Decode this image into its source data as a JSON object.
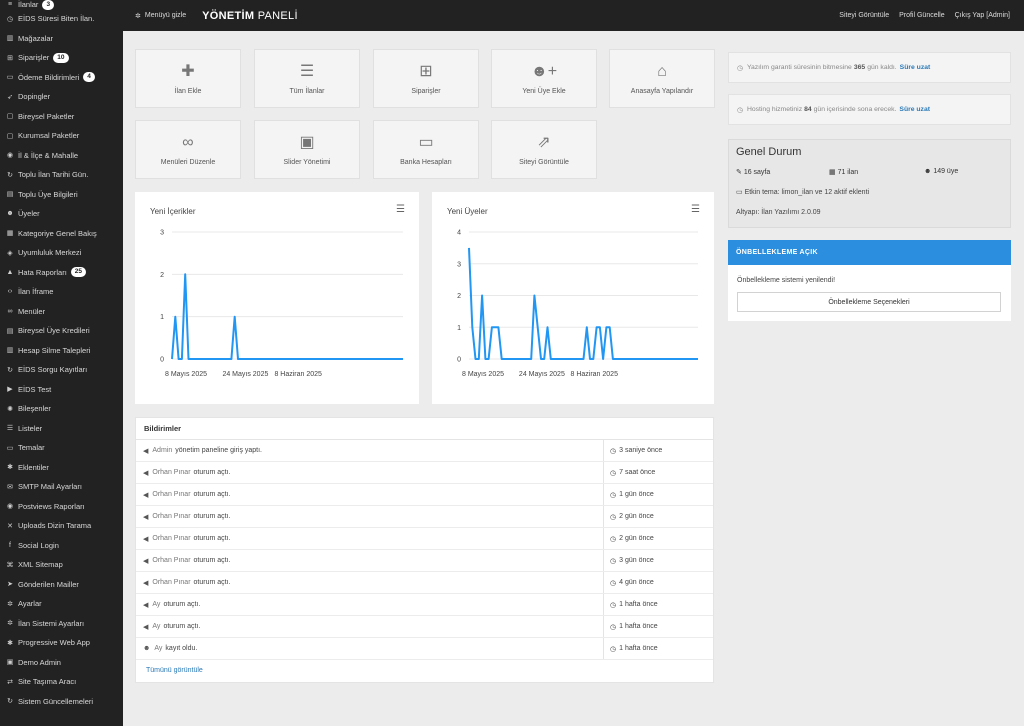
{
  "sidebar": {
    "items": [
      {
        "label": "İlanlar",
        "icon": "list-icon",
        "glyph": "≡",
        "badge": "3"
      },
      {
        "label": "EİDS Süresi Biten İlan.",
        "icon": "clock-icon",
        "glyph": "◷"
      },
      {
        "label": "Mağazalar",
        "icon": "store-icon",
        "glyph": "▥"
      },
      {
        "label": "Siparişler",
        "icon": "cart-icon",
        "glyph": "⊞",
        "badge": "10"
      },
      {
        "label": "Ödeme Bildirimleri",
        "icon": "money-icon",
        "glyph": "▭",
        "badge": "4"
      },
      {
        "label": "Dopingler",
        "icon": "rocket-icon",
        "glyph": "➶"
      },
      {
        "label": "Bireysel Paketler",
        "icon": "box-icon",
        "glyph": "▢"
      },
      {
        "label": "Kurumsal Paketler",
        "icon": "box-icon",
        "glyph": "▢"
      },
      {
        "label": "İl & İlçe & Mahalle",
        "icon": "map-marker-icon",
        "glyph": "◉"
      },
      {
        "label": "Toplu İlan Tarihi Gün.",
        "icon": "refresh-icon",
        "glyph": "↻"
      },
      {
        "label": "Toplu Üye Bilgileri",
        "icon": "users-icon",
        "glyph": "▤"
      },
      {
        "label": "Üyeler",
        "icon": "users-icon",
        "glyph": "☻"
      },
      {
        "label": "Kategoriye Genel Bakış",
        "icon": "grid-icon",
        "glyph": "▦"
      },
      {
        "label": "Uyumluluk Merkezi",
        "icon": "shield-icon",
        "glyph": "◈"
      },
      {
        "label": "Hata Raporları",
        "icon": "bell-icon",
        "glyph": "▲",
        "badge": "25"
      },
      {
        "label": "İlan İframe",
        "icon": "code-icon",
        "glyph": "‹›"
      },
      {
        "label": "Menüler",
        "icon": "link-icon",
        "glyph": "∞"
      },
      {
        "label": "Bireysel Üye Kredileri",
        "icon": "credit-icon",
        "glyph": "▤"
      },
      {
        "label": "Hesap Silme Talepleri",
        "icon": "trash-icon",
        "glyph": "▥"
      },
      {
        "label": "EİDS Sorgu Kayıtları",
        "icon": "refresh-icon",
        "glyph": "↻"
      },
      {
        "label": "EİDS Test",
        "icon": "play-icon",
        "glyph": "▶"
      },
      {
        "label": "Bileşenler",
        "icon": "gear-icon",
        "glyph": "✺"
      },
      {
        "label": "Listeler",
        "icon": "list-icon",
        "glyph": "☰"
      },
      {
        "label": "Temalar",
        "icon": "paint-icon",
        "glyph": "▭"
      },
      {
        "label": "Eklentiler",
        "icon": "puzzle-icon",
        "glyph": "✱"
      },
      {
        "label": "SMTP Mail Ayarları",
        "icon": "mail-icon",
        "glyph": "✉"
      },
      {
        "label": "Postviews Raporları",
        "icon": "eye-icon",
        "glyph": "◉"
      },
      {
        "label": "Uploads Dizin Tarama",
        "icon": "close-icon",
        "glyph": "✕"
      },
      {
        "label": "Social Login",
        "icon": "facebook-icon",
        "glyph": "f"
      },
      {
        "label": "XML Sitemap",
        "icon": "sitemap-icon",
        "glyph": "⌘"
      },
      {
        "label": "Gönderilen Mailler",
        "icon": "send-icon",
        "glyph": "➤"
      },
      {
        "label": "Ayarlar",
        "icon": "gear-icon",
        "glyph": "✲"
      },
      {
        "label": "İlan Sistemi Ayarları",
        "icon": "gears-icon",
        "glyph": "✲"
      },
      {
        "label": "Progressive Web App",
        "icon": "mobile-icon",
        "glyph": "✱"
      },
      {
        "label": "Demo Admin",
        "icon": "lock-icon",
        "glyph": "▣"
      },
      {
        "label": "Site Taşıma Aracı",
        "icon": "truck-icon",
        "glyph": "⇄"
      },
      {
        "label": "Sistem Güncellemeleri",
        "icon": "refresh-icon",
        "glyph": "↻"
      }
    ]
  },
  "topbar": {
    "menu_toggle": "Menüyü gizle",
    "brand_bold": "YÖNETİM",
    "brand_rest": " PANELİ",
    "links": [
      "Siteyi Görüntüle",
      "Profil Güncelle",
      "Çıkış Yap [Admin]"
    ]
  },
  "tiles": [
    {
      "label": "İlan Ekle",
      "icon": "plus-icon",
      "glyph": "✚"
    },
    {
      "label": "Tüm İlanlar",
      "icon": "list-icon",
      "glyph": "☰"
    },
    {
      "label": "Siparişler",
      "icon": "cart-icon",
      "glyph": "⊞"
    },
    {
      "label": "Yeni Üye Ekle",
      "icon": "user-plus-icon",
      "glyph": "☻+"
    },
    {
      "label": "Anasayfa Yapılandır",
      "icon": "home-icon",
      "glyph": "⌂"
    },
    {
      "label": "Menüleri Düzenle",
      "icon": "link-icon",
      "glyph": "∞"
    },
    {
      "label": "Slider Yönetimi",
      "icon": "image-icon",
      "glyph": "▣"
    },
    {
      "label": "Banka Hesapları",
      "icon": "money-icon",
      "glyph": "▭"
    },
    {
      "label": "Siteyi Görüntüle",
      "icon": "external-link-icon",
      "glyph": "⇗"
    }
  ],
  "charts": {
    "menu_glyph": "☰",
    "content": {
      "title": "Yeni İçerikler"
    },
    "members": {
      "title": "Yeni Üyeler"
    }
  },
  "chart_data": [
    {
      "type": "line",
      "title": "Yeni İçerikler",
      "xlabel": "",
      "ylabel": "",
      "x_tick_labels": [
        "8 Mayıs 2025",
        "24 Mayıs 2025",
        "8 Haziran 2025"
      ],
      "y_ticks": [
        0,
        1,
        2,
        3
      ],
      "ylim": [
        0,
        3
      ],
      "color": "#2196f3",
      "series": [
        {
          "values": [
            0,
            1,
            0,
            0,
            2,
            0,
            0,
            0,
            0,
            0,
            0,
            0,
            0,
            0,
            0,
            0,
            0,
            0,
            0,
            1,
            0,
            0,
            0,
            0,
            0,
            0,
            0,
            0,
            0,
            0,
            0,
            0,
            0,
            0,
            0,
            0,
            0,
            0,
            0,
            0,
            0,
            0,
            0,
            0,
            0,
            0,
            0,
            0,
            0,
            0,
            0,
            0,
            0,
            0,
            0,
            0,
            0,
            0,
            0,
            0,
            0,
            0,
            0,
            0,
            0,
            0,
            0,
            0,
            0,
            0,
            0
          ]
        }
      ]
    },
    {
      "type": "line",
      "title": "Yeni Üyeler",
      "xlabel": "",
      "ylabel": "",
      "x_tick_labels": [
        "8 Mayıs 2025",
        "24 Mayıs 2025",
        "8 Haziran 2025"
      ],
      "y_ticks": [
        0,
        1,
        2,
        3,
        4
      ],
      "ylim": [
        0,
        4
      ],
      "color": "#2196f3",
      "series": [
        {
          "values": [
            3.5,
            1,
            0,
            0,
            2,
            0,
            0,
            1,
            1,
            1,
            0,
            0,
            0,
            0,
            0,
            0,
            0,
            0,
            0,
            0,
            2,
            1,
            0,
            0,
            1,
            0,
            0,
            0,
            0,
            0,
            0,
            0,
            0,
            0,
            0,
            0,
            1,
            0,
            0,
            1,
            1,
            0,
            1,
            1,
            0,
            0,
            0,
            0,
            0,
            0,
            0,
            0,
            0,
            0,
            0,
            0,
            0,
            0,
            0,
            0,
            0,
            0,
            0,
            0,
            0,
            0,
            0,
            0,
            0,
            0,
            0
          ]
        }
      ]
    }
  ],
  "notifications": {
    "title": "Bildirimler",
    "rows": [
      {
        "icon": "megaphone-icon",
        "glyph": "◀",
        "name": "Admin",
        "text": "yönetim paneline giriş yaptı.",
        "time": "3 saniye önce"
      },
      {
        "icon": "megaphone-icon",
        "glyph": "◀",
        "name": "Orhan Pınar",
        "text": "oturum açtı.",
        "time": "7 saat önce"
      },
      {
        "icon": "megaphone-icon",
        "glyph": "◀",
        "name": "Orhan Pınar",
        "text": "oturum açtı.",
        "time": "1 gün önce"
      },
      {
        "icon": "megaphone-icon",
        "glyph": "◀",
        "name": "Orhan Pınar",
        "text": "oturum açtı.",
        "time": "2 gün önce"
      },
      {
        "icon": "megaphone-icon",
        "glyph": "◀",
        "name": "Orhan Pınar",
        "text": "oturum açtı.",
        "time": "2 gün önce"
      },
      {
        "icon": "megaphone-icon",
        "glyph": "◀",
        "name": "Orhan Pınar",
        "text": "oturum açtı.",
        "time": "3 gün önce"
      },
      {
        "icon": "megaphone-icon",
        "glyph": "◀",
        "name": "Orhan Pınar",
        "text": "oturum açtı.",
        "time": "4 gün önce"
      },
      {
        "icon": "megaphone-icon",
        "glyph": "◀",
        "name": "Ay",
        "text": "oturum açtı.",
        "time": "1 hafta önce"
      },
      {
        "icon": "megaphone-icon",
        "glyph": "◀",
        "name": "Ay",
        "text": "oturum açtı.",
        "time": "1 hafta önce"
      },
      {
        "icon": "user-plus-icon",
        "glyph": "☻",
        "name": "Ay",
        "text": "kayıt oldu.",
        "time": "1 hafta önce"
      }
    ],
    "time_glyph": "◷",
    "see_all": "Tümünü görüntüle"
  },
  "info": {
    "warranty": {
      "prefix": "Yazılım garanti süresinin bitmesine",
      "days": "365",
      "suffix": "gün kaldı.",
      "link": "Süre uzat"
    },
    "hosting": {
      "prefix": "Hosting hizmetiniz",
      "days": "84",
      "suffix": "gün içerisinde sona erecek.",
      "link": "Süre uzat"
    }
  },
  "status": {
    "title": "Genel Durum",
    "pages": "16 sayfa",
    "listings": "71 ilan",
    "members": "149 üye",
    "theme_line": "Etkin tema: limon_ilan ve 12 aktif eklenti",
    "infra_line": "Altyapı: İlan Yazılımı 2.0.09"
  },
  "cache": {
    "header": "ÖNBELLEKLEME AÇIK",
    "message": "Önbellekleme sistemi yenilendi!",
    "button": "Önbellekleme Seçenekleri"
  },
  "colors": {
    "accent": "#2c8ede",
    "sidebar_bg": "#222222",
    "chart_line": "#2196f3"
  }
}
